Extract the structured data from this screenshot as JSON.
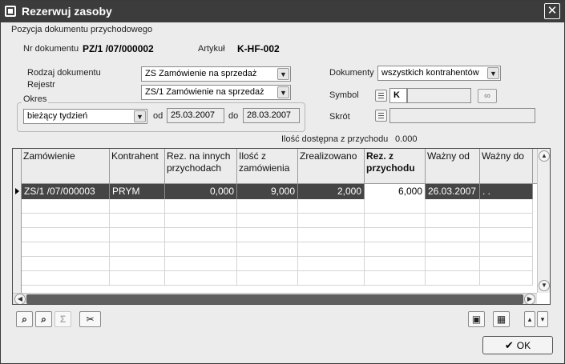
{
  "window": {
    "title": "Rezerwuj zasoby",
    "close_glyph": "✕"
  },
  "section": {
    "title": "Pozycja dokumentu przychodowego"
  },
  "document": {
    "nr_label": "Nr dokumentu",
    "nr_value": "PZ/1  /07/000002",
    "artykul_label": "Artykuł",
    "artykul_value": "K-HF-002"
  },
  "filters": {
    "rodzaj_label": "Rodzaj dokumentu",
    "rodzaj_value": "ZS Zamówienie na sprzedaż",
    "rejestr_label": "Rejestr",
    "rejestr_value": "ZS/1   Zamówienie na sprzedaż",
    "okres_label": "Okres",
    "okres_value": "bieżący tydzień",
    "od_label": "od",
    "od_value": "25.03.2007",
    "do_label": "do",
    "do_value": "28.03.2007",
    "dokumenty_label": "Dokumenty",
    "dokumenty_value": "wszystkich kontrahentów",
    "symbol_label": "Symbol",
    "symbol_value": "K",
    "skrot_label": "Skrót"
  },
  "available": {
    "label": "Ilość dostępna z przychodu",
    "value": "0.000"
  },
  "grid": {
    "columns": [
      {
        "label": "Zamówienie",
        "bold": false
      },
      {
        "label": "Kontrahent",
        "bold": false
      },
      {
        "label": "Rez. na innych przychodach",
        "bold": false
      },
      {
        "label": "Ilość z zamówienia",
        "bold": false
      },
      {
        "label": "Zrealizowano",
        "bold": false
      },
      {
        "label": "Rez. z przychodu",
        "bold": true
      },
      {
        "label": "Ważny od",
        "bold": false
      },
      {
        "label": "Ważny do",
        "bold": false
      }
    ],
    "rows": [
      [
        "ZS/1  /07/000003",
        "PRYM",
        "0,000",
        "9,000",
        "2,000",
        "6,000",
        "26.03.2007",
        ".  ."
      ]
    ]
  },
  "toolbar": {
    "find_icon": "binoculars-icon",
    "filter_icon": "filter-binoculars-icon",
    "sum_label": "Σ",
    "tools_icon": "tools-icon",
    "save_icon": "save-icon",
    "calc_icon": "calculator-icon",
    "expand_icon": "expand-rows-icon"
  },
  "ok_button": {
    "label": "OK",
    "icon": "check-icon"
  }
}
